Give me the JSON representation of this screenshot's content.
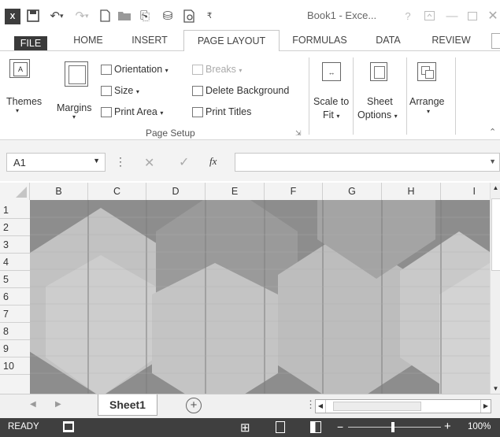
{
  "title_bar": {
    "app_icon": "X",
    "title": "Book1 - Exce...",
    "help": "?"
  },
  "tabs": [
    {
      "label": "FILE"
    },
    {
      "label": "HOME"
    },
    {
      "label": "INSERT"
    },
    {
      "label": "PAGE LAYOUT"
    },
    {
      "label": "FORMULAS"
    },
    {
      "label": "DATA"
    },
    {
      "label": "REVIEW"
    }
  ],
  "ribbon": {
    "themes": "Themes",
    "margins": "Margins",
    "orientation": "Orientation",
    "size": "Size",
    "print_area": "Print Area",
    "breaks": "Breaks",
    "delete_background": "Delete Background",
    "print_titles": "Print Titles",
    "group_page_setup": "Page Setup",
    "scale_to_fit_1": "Scale to",
    "scale_to_fit_2": "Fit",
    "sheet_options_1": "Sheet",
    "sheet_options_2": "Options",
    "arrange": "Arrange"
  },
  "formula_bar": {
    "name_box": "A1",
    "fx": "fx",
    "value": ""
  },
  "columns": [
    "B",
    "C",
    "D",
    "E",
    "F",
    "G",
    "H",
    "I"
  ],
  "rows": [
    "1",
    "2",
    "3",
    "4",
    "5",
    "6",
    "7",
    "8",
    "9",
    "10"
  ],
  "sheets": [
    {
      "label": "Sheet1",
      "active": true
    }
  ],
  "status": {
    "mode": "READY",
    "zoom": "100%"
  },
  "colors": {
    "status_bg": "#3f3f3f",
    "background_dark": "#8d8d8d",
    "background_light": "#d3d3d3"
  }
}
